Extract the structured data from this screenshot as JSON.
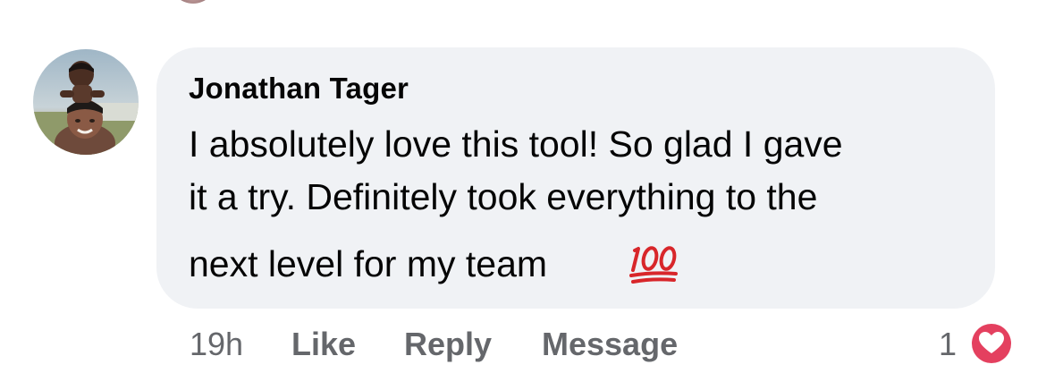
{
  "comment": {
    "author": "Jonathan Tager",
    "lines": [
      "I absolutely love this tool! So glad I gave",
      "it a try. Definitely took everything to the",
      "next level for my team"
    ],
    "emoji_icon": "hundred-points-icon"
  },
  "actions": {
    "time": "19h",
    "like": "Like",
    "reply": "Reply",
    "message": "Message"
  },
  "reactions": {
    "count": "1",
    "icon": "heart-icon"
  },
  "colors": {
    "bubble": "#f0f2f5",
    "text": "#050505",
    "meta": "#65676b",
    "heart": "#e4405f"
  }
}
